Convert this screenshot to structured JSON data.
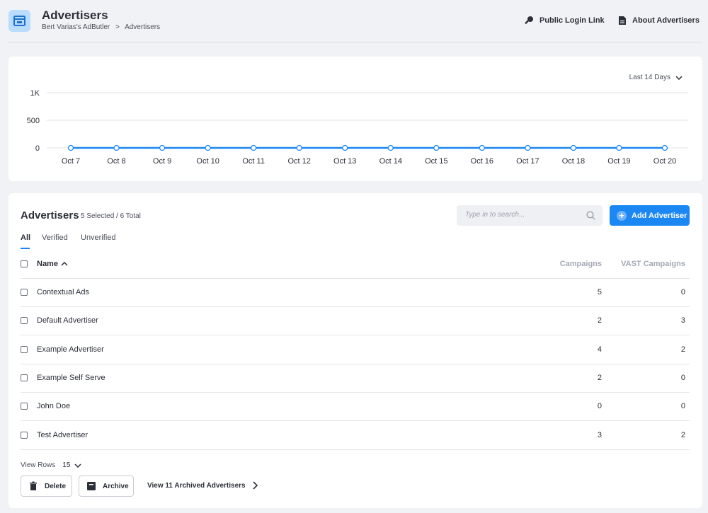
{
  "header": {
    "title": "Advertisers",
    "breadcrumb": [
      "Bert Varias's AdButler",
      ">",
      "Advertisers"
    ],
    "links": [
      {
        "label": "Public Login Link",
        "icon": "key-icon"
      },
      {
        "label": "About Advertisers",
        "icon": "document-icon"
      }
    ]
  },
  "chart_section": {
    "range_label": "Last 14 Days",
    "chart_data": {
      "type": "line",
      "categories": [
        "Oct 7",
        "Oct 8",
        "Oct 9",
        "Oct 10",
        "Oct 11",
        "Oct 12",
        "Oct 13",
        "Oct 14",
        "Oct 15",
        "Oct 16",
        "Oct 17",
        "Oct 18",
        "Oct 19",
        "Oct 20"
      ],
      "series": [
        {
          "values": [
            0,
            0,
            0,
            0,
            0,
            0,
            0,
            0,
            0,
            0,
            0,
            0,
            0,
            0
          ],
          "color": "#1b87f3"
        }
      ],
      "ylim": [
        0,
        1000
      ],
      "yticks": [
        0,
        500,
        1000
      ],
      "ytick_labels": [
        "0",
        "500",
        "1K"
      ],
      "grid": true
    }
  },
  "advertisers": {
    "title": "Advertisers",
    "selection": "5 Selected / 6 Total",
    "search_placeholder": "Type in to search...",
    "add_button": "Add Advertiser",
    "tabs": [
      "All",
      "Verified",
      "Unverified"
    ],
    "columns": {
      "name": "Name",
      "campaigns": "Campaigns",
      "vast": "VAST Campaigns"
    },
    "rows": [
      {
        "name": "Contextual Ads",
        "campaigns": "5",
        "vast": "0"
      },
      {
        "name": "Default Advertiser",
        "campaigns": "2",
        "vast": "3"
      },
      {
        "name": "Example Advertiser",
        "campaigns": "4",
        "vast": "2"
      },
      {
        "name": "Example Self Serve",
        "campaigns": "2",
        "vast": "0"
      },
      {
        "name": "John Doe",
        "campaigns": "0",
        "vast": "0"
      },
      {
        "name": "Test Advertiser",
        "campaigns": "3",
        "vast": "2"
      }
    ],
    "view_rows_label": "View Rows",
    "view_rows_value": "15",
    "delete_button": "Delete",
    "archive_button": "Archive",
    "archived_link": "View 11 Archived Advertisers"
  },
  "colors": {
    "accent": "#1b87f3",
    "background": "#f1f2f5"
  }
}
